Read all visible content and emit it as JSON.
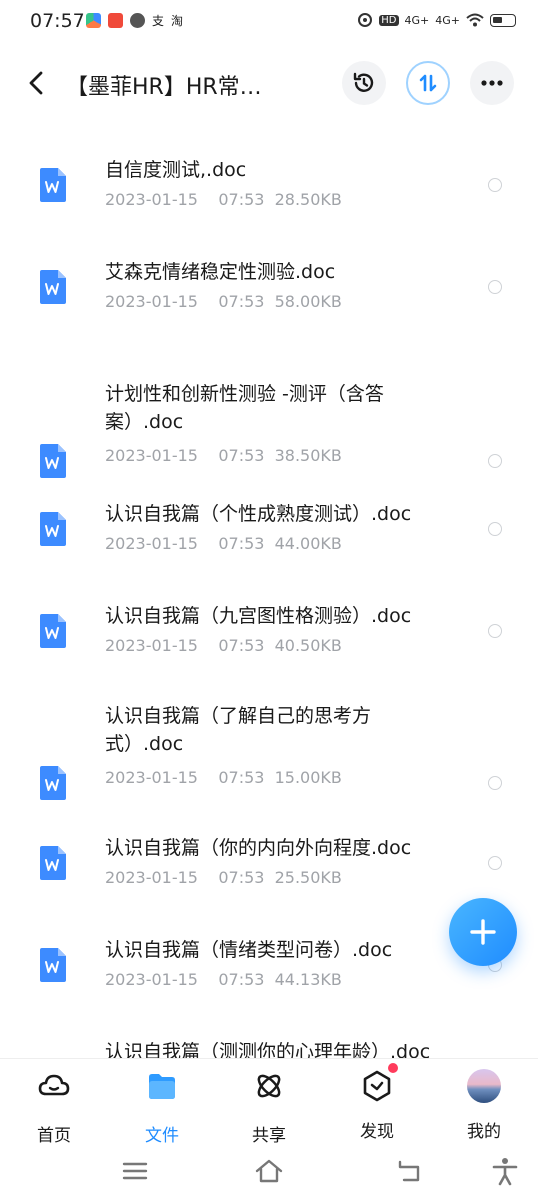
{
  "status_bar": {
    "time": "07:57",
    "network_badge": "HD",
    "signal1": "4G+",
    "signal2": "4G+",
    "icons": [
      "cloud-app-icon",
      "news-app-icon",
      "chat-icon",
      "alipay-icon",
      "taobao-icon",
      "alarm-icon",
      "wifi-icon",
      "battery-icon"
    ]
  },
  "header": {
    "title": "【墨菲HR】HR常…",
    "buttons": [
      "history-icon",
      "sort-icon",
      "more-icon"
    ]
  },
  "files": [
    {
      "name": "自信度测试,.doc",
      "date": "2023-01-15",
      "time": "07:53",
      "size": "28.50KB"
    },
    {
      "name": "艾森克情绪稳定性测验.doc",
      "date": "2023-01-15",
      "time": "07:53",
      "size": "58.00KB"
    },
    {
      "name": "计划性和创新性测验 -测评（含答案）.doc",
      "date": "2023-01-15",
      "time": "07:53",
      "size": "38.50KB"
    },
    {
      "name": "认识自我篇（个性成熟度测试）.doc",
      "date": "2023-01-15",
      "time": "07:53",
      "size": "44.00KB"
    },
    {
      "name": "认识自我篇（九宫图性格测验）.doc",
      "date": "2023-01-15",
      "time": "07:53",
      "size": "40.50KB"
    },
    {
      "name": "认识自我篇（了解自己的思考方式）.doc",
      "date": "2023-01-15",
      "time": "07:53",
      "size": "15.00KB"
    },
    {
      "name": "认识自我篇（你的内向外向程度.doc",
      "date": "2023-01-15",
      "time": "07:53",
      "size": "25.50KB"
    },
    {
      "name": "认识自我篇（情绪类型问卷）.doc",
      "date": "2023-01-15",
      "time": "07:53",
      "size": "44.13KB"
    },
    {
      "name": "认识自我篇（测测你的心理年龄）.doc",
      "date": "",
      "time": "",
      "size": ""
    }
  ],
  "fab_icon": "plus-icon",
  "bottom_nav": [
    {
      "label": "首页",
      "icon": "cloud-icon",
      "active": false
    },
    {
      "label": "文件",
      "icon": "folder-icon",
      "active": true
    },
    {
      "label": "共享",
      "icon": "share-atom-icon",
      "active": false
    },
    {
      "label": "发现",
      "icon": "discover-icon",
      "active": false,
      "badge_dot": true
    },
    {
      "label": "我的",
      "icon": "avatar",
      "active": false
    }
  ],
  "system_nav": [
    "menu-icon",
    "home-icon",
    "back-icon",
    "accessibility-icon"
  ],
  "colors": {
    "accent": "#1f8cff",
    "doc_icon": "#3d8bff",
    "meta_text": "#a0a3a8",
    "badge": "#ff3b5c"
  }
}
